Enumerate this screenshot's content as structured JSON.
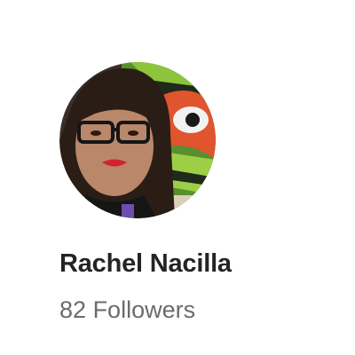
{
  "profile": {
    "name": "Rachel Nacilla",
    "followers_count": "82",
    "followers_label": "Followers",
    "avatar_icon": "avatar-photo"
  },
  "colors": {
    "name_text": "#242424",
    "secondary_text": "#6b6b6b",
    "background": "#ffffff"
  }
}
